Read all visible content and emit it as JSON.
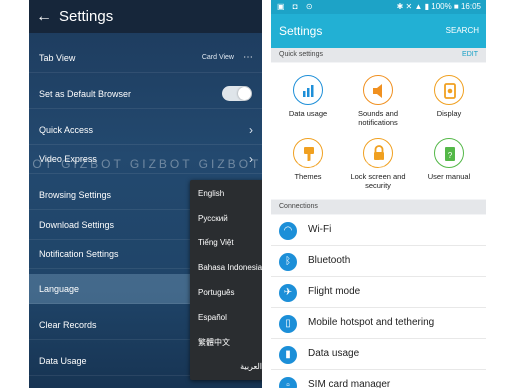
{
  "left": {
    "back_icon": "←",
    "title": "Settings",
    "rows": [
      {
        "label": "Tab View",
        "value": "Card View",
        "menu": "⋯"
      },
      {
        "label": "Set as Default Browser"
      },
      {
        "label": "Quick Access"
      },
      {
        "label": "Video Express"
      },
      {
        "label": "Browsing Settings"
      },
      {
        "label": "Download Settings"
      },
      {
        "label": "Notification Settings"
      },
      {
        "label": "Language"
      },
      {
        "label": "Clear Records"
      },
      {
        "label": "Data Usage"
      }
    ],
    "languages": [
      "English",
      "Русский",
      "Tiếng Việt",
      "Bahasa Indonesia",
      "Português",
      "Español",
      "繁體中文",
      "العربية"
    ]
  },
  "right": {
    "status_left": "▣ ◘ ⊙",
    "status_right": "✱ ✕ ▲ ▮ 100% ■ 16:05",
    "title": "Settings",
    "search": "SEARCH",
    "quick_settings_header": "Quick settings",
    "edit": "EDIT",
    "quick": [
      {
        "label": "Data usage",
        "color": "#1e8fd8"
      },
      {
        "label": "Sounds and notifications",
        "color": "#f09020"
      },
      {
        "label": "Display",
        "color": "#f0a020"
      },
      {
        "label": "Themes",
        "color": "#f0a020"
      },
      {
        "label": "Lock screen and security",
        "color": "#f0a020"
      },
      {
        "label": "User manual",
        "color": "#54b848"
      }
    ],
    "connections_header": "Connections",
    "connections": [
      {
        "label": "Wi-Fi",
        "icon": "wifi-icon"
      },
      {
        "label": "Bluetooth",
        "icon": "bluetooth-icon"
      },
      {
        "label": "Flight mode",
        "icon": "airplane-icon"
      },
      {
        "label": "Mobile hotspot and tethering",
        "icon": "hotspot-icon"
      },
      {
        "label": "Data usage",
        "icon": "data-usage-icon"
      },
      {
        "label": "SIM card manager",
        "icon": "sim-icon"
      }
    ]
  },
  "watermark": "ZEBOT  GIZBOT  GIZBOT  GIZBOT  GIZBOT  GIZBO"
}
